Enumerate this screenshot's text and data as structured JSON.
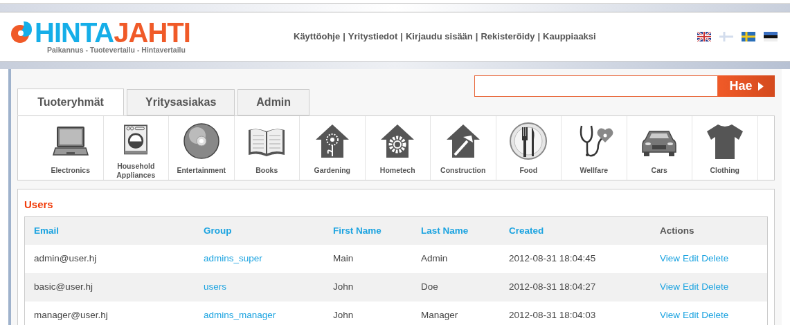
{
  "logo": {
    "part_1": "HINTA",
    "part_2": "JAHTI",
    "tagline": "Paikannus - Tuotevertailu - Hintavertailu"
  },
  "nav": {
    "separator": "|",
    "links": [
      "Käyttöohje",
      "Yritystiedot",
      "Kirjaudu sisään",
      "Rekisteröidy",
      "Kauppiaaksi"
    ]
  },
  "languages": [
    {
      "selected": false
    },
    {
      "selected": true
    },
    {
      "selected": false
    },
    {
      "selected": false
    }
  ],
  "tabs": [
    {
      "label": "Tuoteryhmät",
      "selected": true
    },
    {
      "label": "Yritysasiakas",
      "selected": false
    },
    {
      "label": "Admin",
      "selected": false
    }
  ],
  "search": {
    "button": "Hae"
  },
  "categories": [
    "Electronics",
    "Household Appliances",
    "Entertainment",
    "Books",
    "Gardening",
    "Hometech",
    "Construction",
    "Food",
    "Wellfare",
    "Cars",
    "Clothing"
  ],
  "users": {
    "title": "Users",
    "columns": [
      {
        "label": "Email",
        "sortable": true
      },
      {
        "label": "Group",
        "sortable": true
      },
      {
        "label": "First Name",
        "sortable": true
      },
      {
        "label": "Last Name",
        "sortable": true
      },
      {
        "label": "Created",
        "sortable": true
      },
      {
        "label": "Actions",
        "sortable": false
      }
    ],
    "rows": [
      {
        "email": "admin@user.hj",
        "group": "admins_super",
        "first_name": "Main",
        "last_name": "Admin",
        "created": "2012-08-31 18:04:45",
        "actions": [
          "View",
          "Edit",
          "Delete"
        ]
      },
      {
        "email": "basic@user.hj",
        "group": "users",
        "first_name": "John",
        "last_name": "Doe",
        "created": "2012-08-31 18:04:27",
        "actions": [
          "View",
          "Edit",
          "Delete"
        ]
      },
      {
        "email": "manager@user.hj",
        "group": "admins_manager",
        "first_name": "John",
        "last_name": "Manager",
        "created": "2012-08-31 18:04:03",
        "actions": [
          "View",
          "Edit",
          "Delete"
        ]
      }
    ]
  }
}
